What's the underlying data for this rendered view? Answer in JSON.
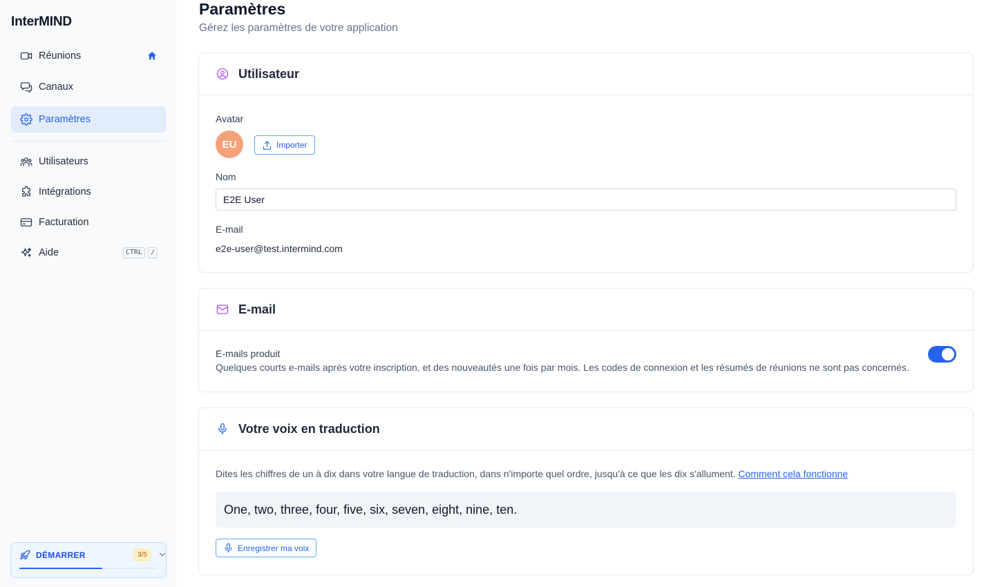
{
  "app": {
    "brand": "InterMIND"
  },
  "sidebar": {
    "items": [
      {
        "label": "Réunions",
        "icon": "video-camera-icon"
      },
      {
        "label": "Canaux",
        "icon": "chat-bubbles-icon"
      },
      {
        "label": "Paramètres",
        "icon": "gear-icon",
        "active": true
      },
      {
        "label": "Utilisateurs",
        "icon": "users-icon"
      },
      {
        "label": "Intégrations",
        "icon": "puzzle-icon"
      },
      {
        "label": "Facturation",
        "icon": "credit-card-icon"
      },
      {
        "label": "Aide",
        "icon": "sparkles-icon"
      }
    ],
    "help_shortcut": {
      "key1": "CTRL",
      "key2": "/"
    },
    "starter": {
      "label": "DÉMARRER",
      "badge": "3/5",
      "progress": 0.6
    }
  },
  "page": {
    "title": "Paramètres",
    "subtitle": "Gérez les paramètres de votre application"
  },
  "user_card": {
    "title": "Utilisateur",
    "avatar_label": "Avatar",
    "avatar_initials": "EU",
    "import_label": "Importer",
    "name_label": "Nom",
    "name_value": "E2E User",
    "email_label": "E-mail",
    "email_value": "e2e-user@test.intermind.com"
  },
  "email_card": {
    "title": "E-mail",
    "product_label": "E-mails produit",
    "product_description": "Quelques courts e-mails après votre inscription, et des nouveautés une fois par mois. Les codes de connexion et les résumés de réunions ne sont pas concernés.",
    "enabled": true
  },
  "voice_card": {
    "title": "Votre voix en traduction",
    "instructions": "Dites les chiffres de un à dix dans votre langue de traduction, dans n'importe quel ordre, jusqu'à ce que les dix s'allument.",
    "help_link": "Comment cela fonctionne",
    "phrase": "One, two, three, four, five, six, seven, eight, nine, ten.",
    "record_label": "Enregistrer ma voix"
  },
  "colors": {
    "accent": "#2563eb",
    "avatar": "#f5a27a",
    "section_icon": "#a855f7"
  }
}
